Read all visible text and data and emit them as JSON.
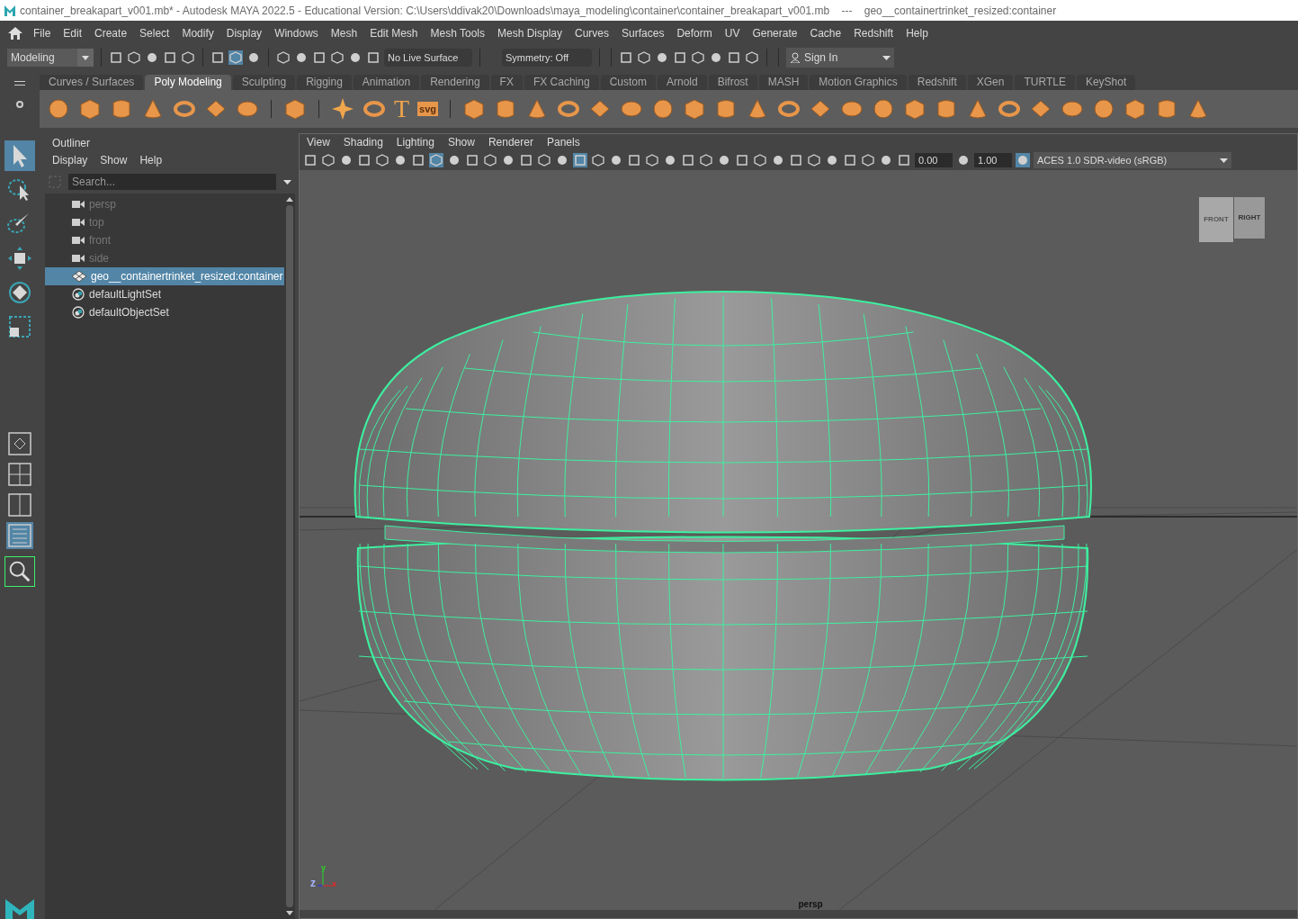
{
  "title_bar": {
    "title": "container_breakapart_v001.mb* - Autodesk MAYA 2022.5 - Educational Version: C:\\Users\\ddivak20\\Downloads\\maya_modeling\\container\\container_breakapart_v001.mb    ---    geo__containertrinket_resized:container"
  },
  "menu_bar": [
    "File",
    "Edit",
    "Create",
    "Select",
    "Modify",
    "Display",
    "Windows",
    "Mesh",
    "Edit Mesh",
    "Mesh Tools",
    "Mesh Display",
    "Curves",
    "Surfaces",
    "Deform",
    "UV",
    "Generate",
    "Cache",
    "Redshift",
    "Help"
  ],
  "status_line": {
    "mode": "Modeling",
    "live_surface": "No Live Surface",
    "symmetry": "Symmetry: Off",
    "sign_in": "Sign In"
  },
  "shelf_tabs": [
    {
      "label": "Curves / Surfaces",
      "selected": false
    },
    {
      "label": "Poly Modeling",
      "selected": true
    },
    {
      "label": "Sculpting",
      "selected": false
    },
    {
      "label": "Rigging",
      "selected": false
    },
    {
      "label": "Animation",
      "selected": false
    },
    {
      "label": "Rendering",
      "selected": false
    },
    {
      "label": "FX",
      "selected": false
    },
    {
      "label": "FX Caching",
      "selected": false
    },
    {
      "label": "Custom",
      "selected": false
    },
    {
      "label": "Arnold",
      "selected": false
    },
    {
      "label": "Bifrost",
      "selected": false
    },
    {
      "label": "MASH",
      "selected": false
    },
    {
      "label": "Motion Graphics",
      "selected": false
    },
    {
      "label": "Redshift",
      "selected": false
    },
    {
      "label": "XGen",
      "selected": false
    },
    {
      "label": "TURTLE",
      "selected": false
    },
    {
      "label": "KeyShot",
      "selected": false
    }
  ],
  "shelf_text_icons": [
    "T",
    "svg"
  ],
  "tools": [
    {
      "kind": "select",
      "selected": true
    },
    {
      "kind": "lasso",
      "selected": false
    },
    {
      "kind": "paint",
      "selected": false
    },
    {
      "kind": "move",
      "selected": false
    },
    {
      "kind": "rotate",
      "selected": false
    },
    {
      "kind": "scale",
      "selected": false
    }
  ],
  "outliner": {
    "title": "Outliner",
    "menu": [
      "Display",
      "Show",
      "Help"
    ],
    "search": {
      "placeholder": "Search..."
    },
    "items": [
      {
        "label": "persp",
        "kind": "camera",
        "dimmed": true,
        "selected": false
      },
      {
        "label": "top",
        "kind": "camera",
        "dimmed": true,
        "selected": false
      },
      {
        "label": "front",
        "kind": "camera",
        "dimmed": true,
        "selected": false
      },
      {
        "label": "side",
        "kind": "camera",
        "dimmed": true,
        "selected": false
      },
      {
        "label": "geo__containertrinket_resized:container",
        "kind": "mesh",
        "dimmed": false,
        "selected": true
      },
      {
        "label": "defaultLightSet",
        "kind": "set",
        "dimmed": false,
        "selected": false
      },
      {
        "label": "defaultObjectSet",
        "kind": "set",
        "dimmed": false,
        "selected": false
      }
    ]
  },
  "viewport": {
    "menu": [
      "View",
      "Shading",
      "Lighting",
      "Show",
      "Renderer",
      "Panels"
    ],
    "exposure": "0.00",
    "gamma": "1.00",
    "color_space": "ACES 1.0 SDR-video (sRGB)",
    "view_cube": {
      "front": "FRONT",
      "right": "RIGHT"
    },
    "axes": {
      "x": "x",
      "y": "y",
      "z": "z"
    },
    "camera_label": "persp"
  }
}
